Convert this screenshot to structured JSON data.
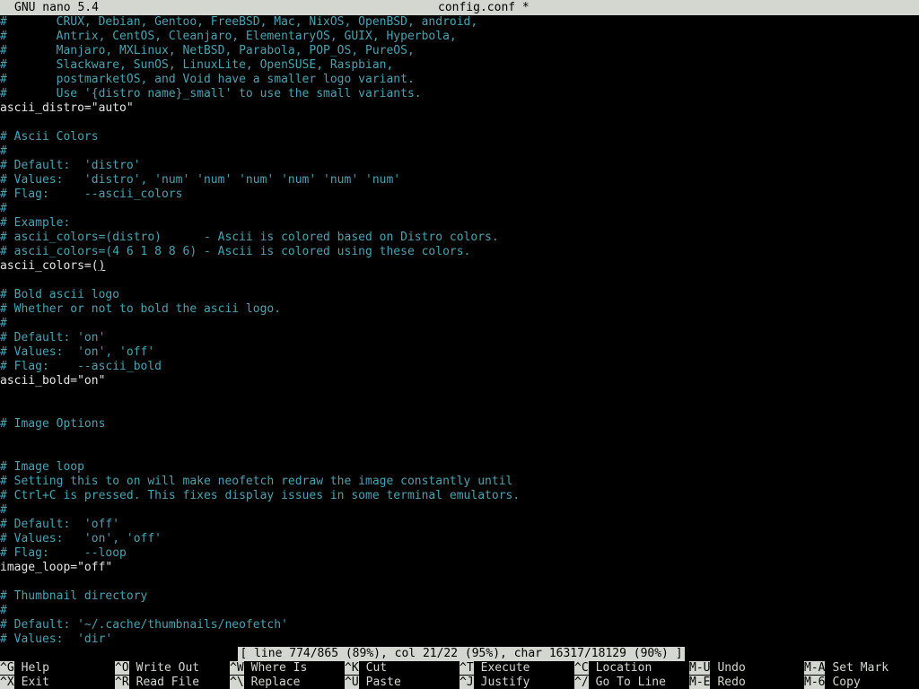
{
  "title_bar": {
    "app": "GNU nano 5.4",
    "file": "config.conf *"
  },
  "editor": {
    "lines": [
      {
        "text": "#       CRUX, Debian, Gentoo, FreeBSD, Mac, NixOS, OpenBSD, android,",
        "kind": "comment"
      },
      {
        "text": "#       Antrix, CentOS, Cleanjaro, ElementaryOS, GUIX, Hyperbola,",
        "kind": "comment"
      },
      {
        "text": "#       Manjaro, MXLinux, NetBSD, Parabola, POP_OS, PureOS,",
        "kind": "comment"
      },
      {
        "text": "#       Slackware, SunOS, LinuxLite, OpenSUSE, Raspbian,",
        "kind": "comment"
      },
      {
        "text": "#       postmarketOS, and Void have a smaller logo variant.",
        "kind": "comment"
      },
      {
        "text": "#       Use '{distro name}_small' to use the small variants.",
        "kind": "comment"
      },
      {
        "text": "ascii_distro=\"auto\"",
        "kind": "code"
      },
      {
        "text": "",
        "kind": "code"
      },
      {
        "text": "# Ascii Colors",
        "kind": "comment"
      },
      {
        "text": "#",
        "kind": "comment"
      },
      {
        "text": "# Default:  'distro'",
        "kind": "comment"
      },
      {
        "text": "# Values:   'distro', 'num' 'num' 'num' 'num' 'num' 'num'",
        "kind": "comment"
      },
      {
        "text": "# Flag:     --ascii_colors",
        "kind": "comment"
      },
      {
        "text": "#",
        "kind": "comment"
      },
      {
        "text": "# Example:",
        "kind": "comment"
      },
      {
        "text": "# ascii_colors=(distro)      - Ascii is colored based on Distro colors.",
        "kind": "comment"
      },
      {
        "text": "# ascii_colors=(4 6 1 8 8 6) - Ascii is colored using these colors.",
        "kind": "comment"
      },
      {
        "text": "ascii_colors=(",
        "kind": "code",
        "cursor": ")"
      },
      {
        "text": "",
        "kind": "code"
      },
      {
        "text": "# Bold ascii logo",
        "kind": "comment"
      },
      {
        "text": "# Whether or not to bold the ascii logo.",
        "kind": "comment"
      },
      {
        "text": "#",
        "kind": "comment"
      },
      {
        "text": "# Default: 'on'",
        "kind": "comment"
      },
      {
        "text": "# Values:  'on', 'off'",
        "kind": "comment"
      },
      {
        "text": "# Flag:    --ascii_bold",
        "kind": "comment"
      },
      {
        "text": "ascii_bold=\"on\"",
        "kind": "code"
      },
      {
        "text": "",
        "kind": "code"
      },
      {
        "text": "",
        "kind": "code"
      },
      {
        "text": "# Image Options",
        "kind": "comment"
      },
      {
        "text": "",
        "kind": "code"
      },
      {
        "text": "",
        "kind": "code"
      },
      {
        "text": "# Image loop",
        "kind": "comment"
      },
      {
        "text": "# Setting this to on will make neofetch redraw the image constantly until",
        "kind": "comment"
      },
      {
        "text": "# Ctrl+C is pressed. This fixes display issues in some terminal emulators.",
        "kind": "comment"
      },
      {
        "text": "#",
        "kind": "comment"
      },
      {
        "text": "# Default:  'off'",
        "kind": "comment"
      },
      {
        "text": "# Values:   'on', 'off'",
        "kind": "comment"
      },
      {
        "text": "# Flag:     --loop",
        "kind": "comment"
      },
      {
        "text": "image_loop=\"off\"",
        "kind": "code"
      },
      {
        "text": "",
        "kind": "code"
      },
      {
        "text": "# Thumbnail directory",
        "kind": "comment"
      },
      {
        "text": "#",
        "kind": "comment"
      },
      {
        "text": "# Default: '~/.cache/thumbnails/neofetch'",
        "kind": "comment"
      },
      {
        "text": "# Values:  'dir'",
        "kind": "comment"
      }
    ]
  },
  "status": {
    "text": "[ line 774/865 (89%), col 21/22 (95%), char 16317/18129 (90%) ]"
  },
  "shortcuts": {
    "row1": [
      {
        "key": "^G",
        "label": "Help"
      },
      {
        "key": "^O",
        "label": "Write Out"
      },
      {
        "key": "^W",
        "label": "Where Is"
      },
      {
        "key": "^K",
        "label": "Cut"
      },
      {
        "key": "^T",
        "label": "Execute"
      },
      {
        "key": "^C",
        "label": "Location"
      },
      {
        "key": "M-U",
        "label": "Undo"
      },
      {
        "key": "M-A",
        "label": "Set Mark"
      }
    ],
    "row2": [
      {
        "key": "^X",
        "label": "Exit"
      },
      {
        "key": "^R",
        "label": "Read File"
      },
      {
        "key": "^\\",
        "label": "Replace"
      },
      {
        "key": "^U",
        "label": "Paste"
      },
      {
        "key": "^J",
        "label": "Justify"
      },
      {
        "key": "^/",
        "label": "Go To Line"
      },
      {
        "key": "M-E",
        "label": "Redo"
      },
      {
        "key": "M-6",
        "label": "Copy"
      }
    ]
  },
  "colors": {
    "background": "#000000",
    "comment": "#4aa3b2",
    "code": "#e4e4e4",
    "bar": "#d3d7cf"
  }
}
